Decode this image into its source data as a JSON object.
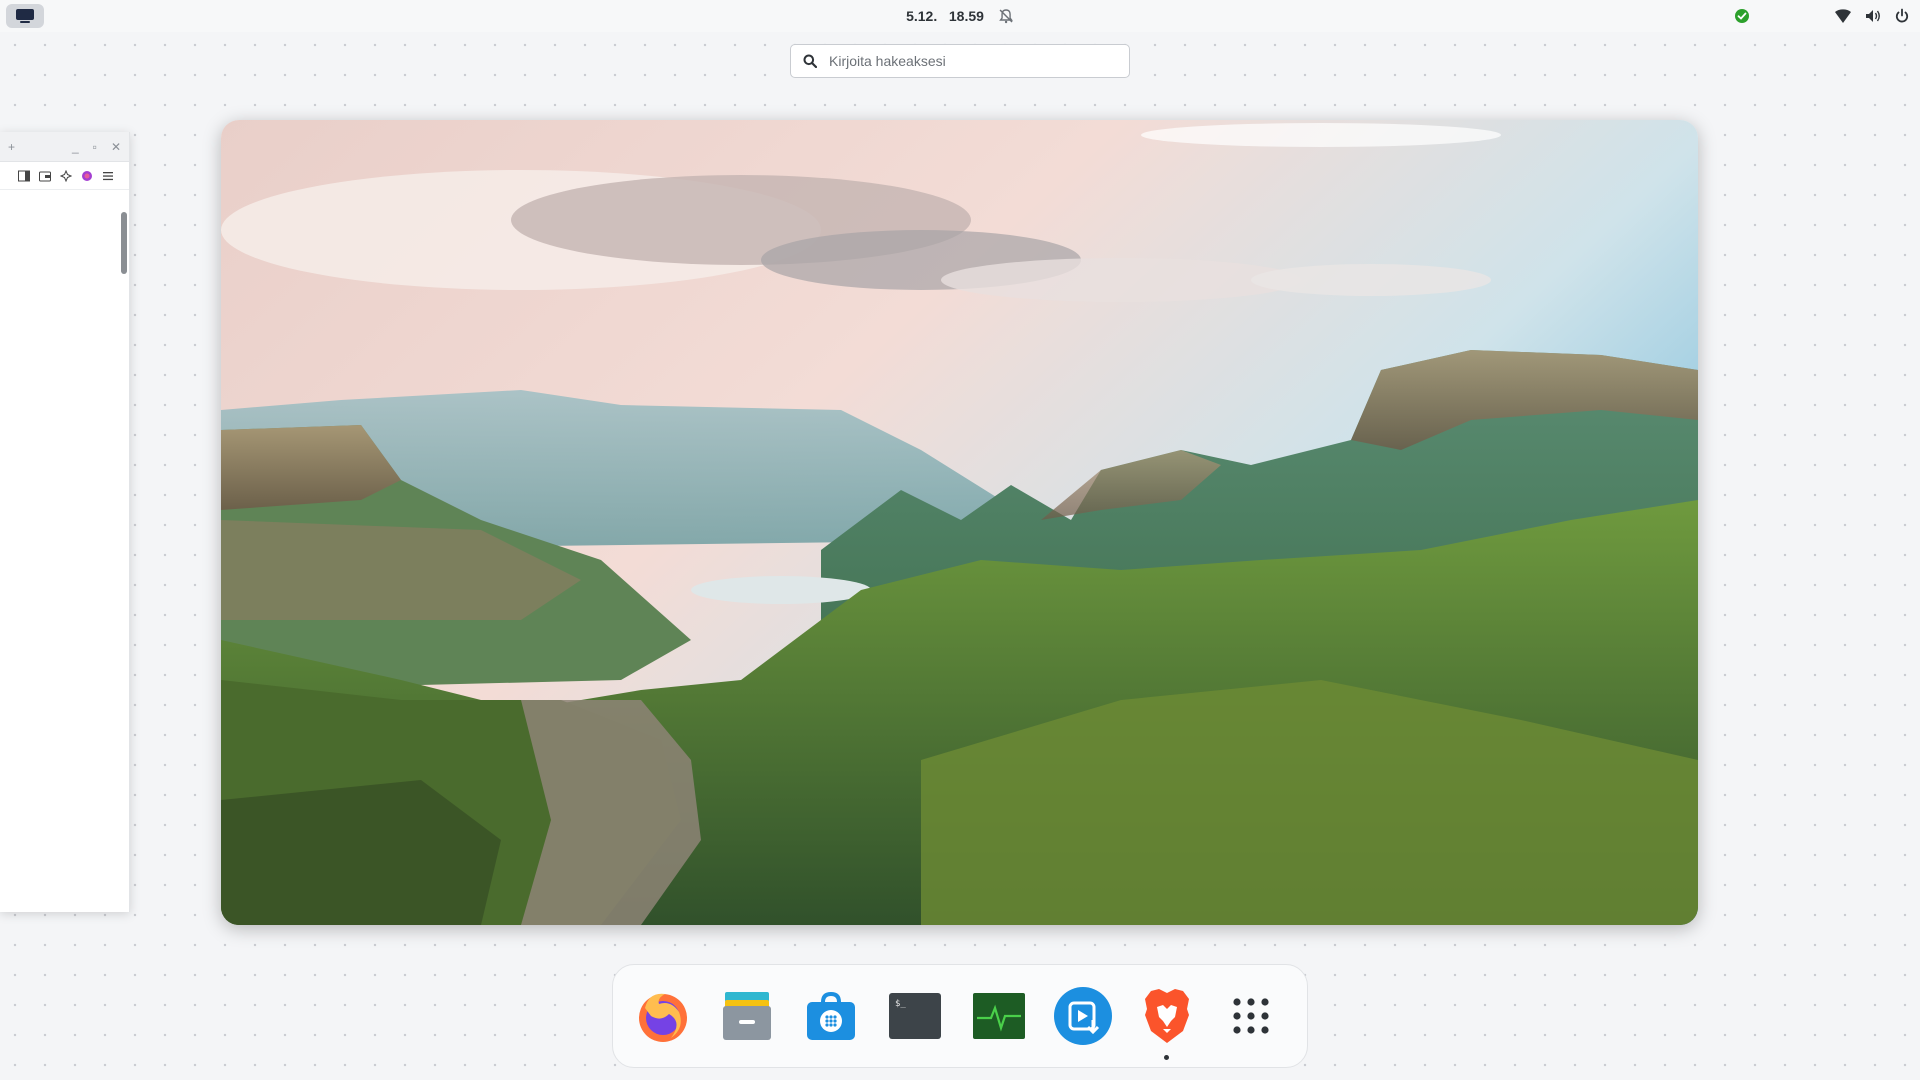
{
  "topbar": {
    "date": "5.12.",
    "time": "18.59"
  },
  "search": {
    "placeholder": "Kirjoita hakeaksesi"
  },
  "dock": {
    "apps": [
      {
        "name": "Firefox",
        "icon": "firefox-icon",
        "running": false
      },
      {
        "name": "Files",
        "icon": "files-icon",
        "running": false
      },
      {
        "name": "Software",
        "icon": "software-store-icon",
        "running": false
      },
      {
        "name": "Terminal",
        "icon": "terminal-icon",
        "running": false
      },
      {
        "name": "System Monitor",
        "icon": "system-monitor-icon",
        "running": false
      },
      {
        "name": "Installer",
        "icon": "installer-icon",
        "running": false
      },
      {
        "name": "Brave",
        "icon": "brave-icon",
        "running": true
      },
      {
        "name": "Show Applications",
        "icon": "app-grid-icon",
        "running": false
      }
    ]
  },
  "colors": {
    "accent_green": "#2ca02c",
    "dock_bg": "#fafbfc",
    "topbar_bg": "#f7f8f9"
  }
}
